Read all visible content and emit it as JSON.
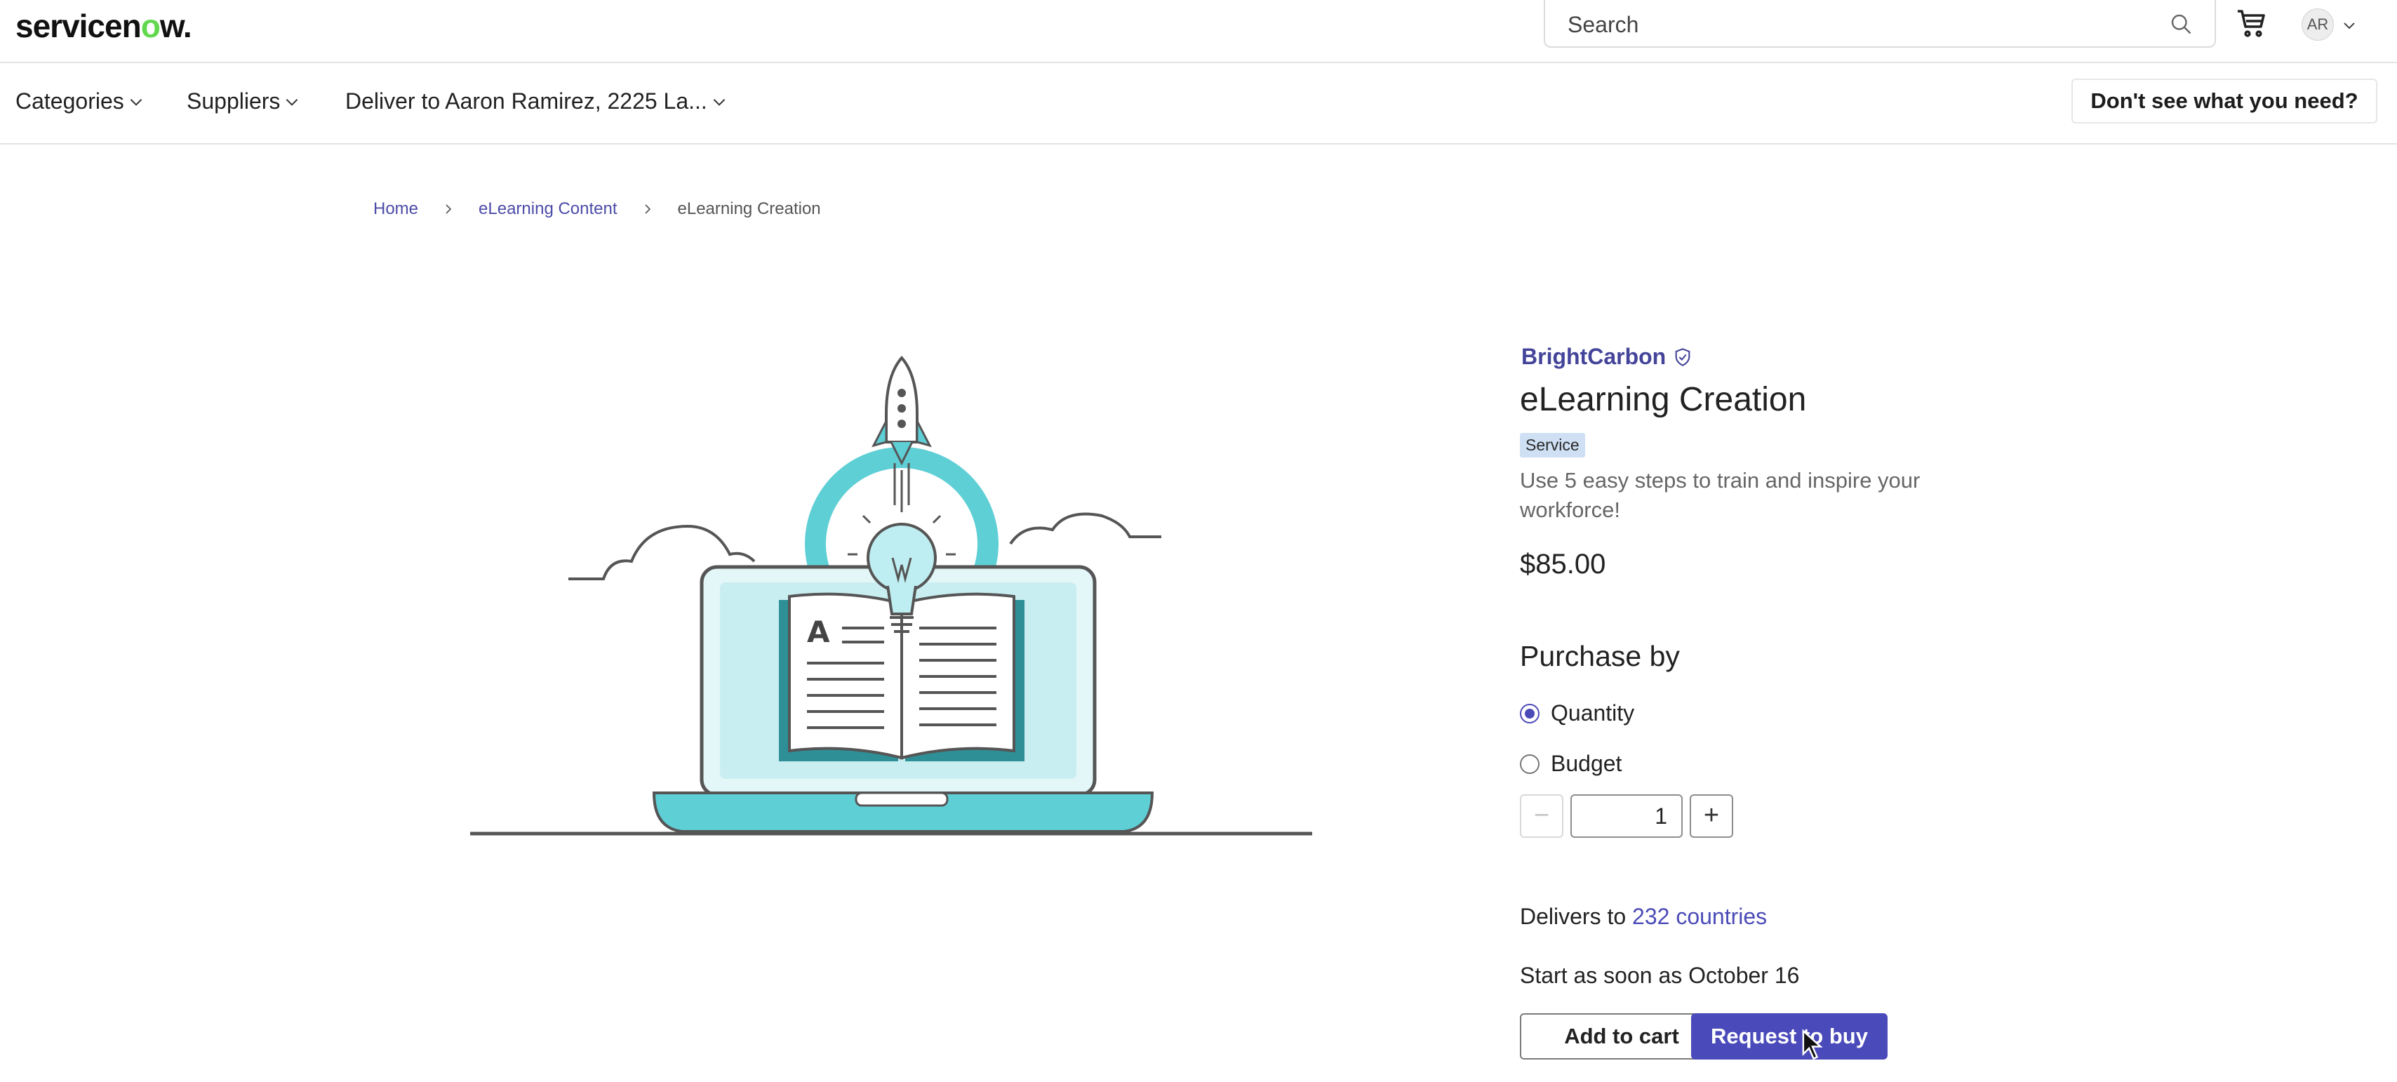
{
  "header": {
    "logo_text_before": "servicen",
    "logo_text_o": "o",
    "logo_text_after": "w.",
    "search_placeholder": "Search",
    "avatar_initials": "AR",
    "icons": {
      "search": "search-icon",
      "cart": "cart-icon",
      "chevron": "chevron-down-icon"
    }
  },
  "nav": {
    "categories": "Categories",
    "suppliers": "Suppliers",
    "deliver_to": "Deliver to Aaron Ramirez, 2225 La...",
    "dont_see": "Don't see what you need?"
  },
  "breadcrumb": [
    "Home",
    "eLearning Content",
    "eLearning Creation"
  ],
  "product": {
    "supplier": "BrightCarbon",
    "title": "eLearning Creation",
    "badge": "Service",
    "description": "Use 5 easy steps to train and inspire your workforce!",
    "price": "$85.00",
    "illustration_icon": "elearning-illustration"
  },
  "purchase": {
    "heading": "Purchase by",
    "options": [
      "Quantity",
      "Budget"
    ],
    "selected": "Quantity",
    "quantity": "1",
    "minus": "−",
    "plus": "+"
  },
  "delivery": {
    "prefix": "Delivers to ",
    "countries_link": "232 countries",
    "start": "Start as soon as October 16"
  },
  "actions": {
    "add_to_cart": "Add to cart",
    "request_to_buy": "Request to buy"
  },
  "colors": {
    "accent": "#4a4aba",
    "illustration_teal": "#5fcfd6",
    "badge_bg": "#cfe0f4",
    "logo_green": "#62d84e"
  }
}
